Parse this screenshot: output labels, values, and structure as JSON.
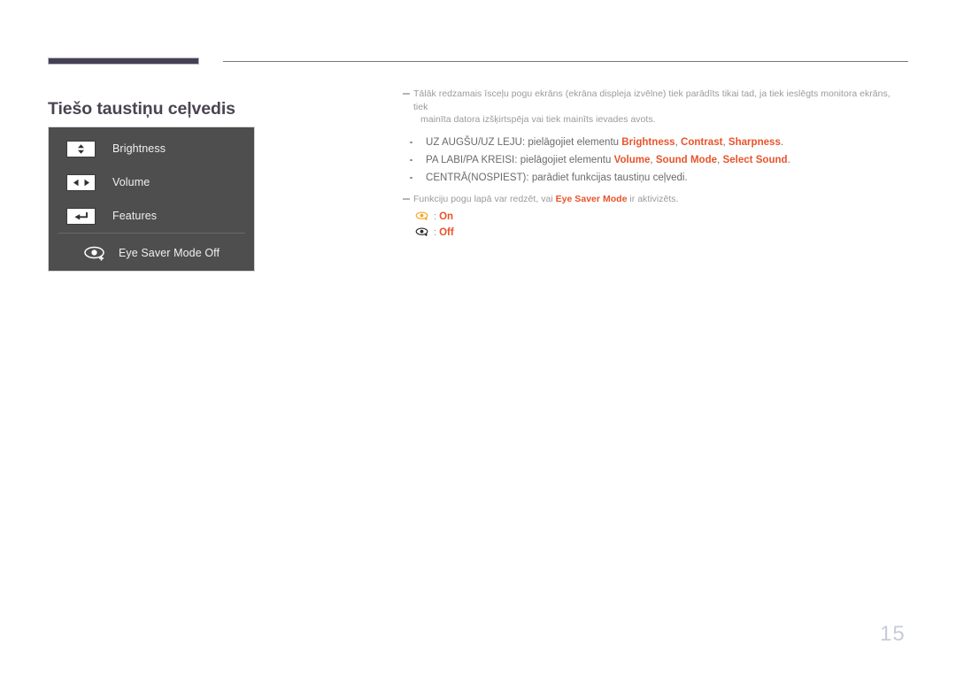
{
  "document": {
    "title": "Tiešo taustiņu ceļvedis",
    "page_number": "15"
  },
  "colors": {
    "header_bar": "#454054",
    "title_text": "#4a4452",
    "osd_panel_bg": "#4e4e4e",
    "highlight_orange": "#e8542a",
    "eye_on_icon": "#f5a623",
    "eye_off_icon": "#2b2b2b",
    "page_number": "#c8cbd8",
    "body_text": "#6a6a6a",
    "note_text": "#9b9b9b"
  },
  "osd_panel": {
    "rows": [
      {
        "icon": "up-down-arrows-icon",
        "label": "Brightness"
      },
      {
        "icon": "left-right-arrows-icon",
        "label": "Volume"
      },
      {
        "icon": "enter-return-arrow-icon",
        "label": "Features"
      }
    ],
    "eye_saver_row": {
      "icon": "eye-saver-icon",
      "label": "Eye Saver Mode Off"
    }
  },
  "content": {
    "note_top": {
      "line1": "Tālāk redzamais īsceļu pogu ekrāns (ekrāna displeja izvēlne) tiek parādīts tikai tad, ja tiek ieslēgts monitora ekrāns, tiek",
      "line2": "mainīta datora izšķirtspēja vai tiek mainīts ievades avots."
    },
    "bullets": [
      {
        "prefix": "UZ AUGŠU/UZ LEJU: pielāgojiet elementu ",
        "terms": [
          "Brightness",
          "Contrast",
          "Sharpness"
        ],
        "suffix": "."
      },
      {
        "prefix": "PA LABI/PA KREISI: pielāgojiet elementu ",
        "terms": [
          "Volume",
          "Sound Mode",
          "Select Sound"
        ],
        "suffix": "."
      },
      {
        "prefix": "CENTRĀ(NOSPIEST): parādiet funkcijas taustiņu ceļvedi.",
        "terms": [],
        "suffix": ""
      }
    ],
    "note_bottom": {
      "prefix": "Funkciju pogu lapā var redzēt, vai ",
      "term": "Eye Saver Mode",
      "suffix": " ir aktivizēts."
    },
    "eye_states": [
      {
        "icon": "eye-saver-on-icon",
        "separator": ":",
        "state": "On"
      },
      {
        "icon": "eye-saver-off-icon",
        "separator": ":",
        "state": "Off"
      }
    ]
  }
}
